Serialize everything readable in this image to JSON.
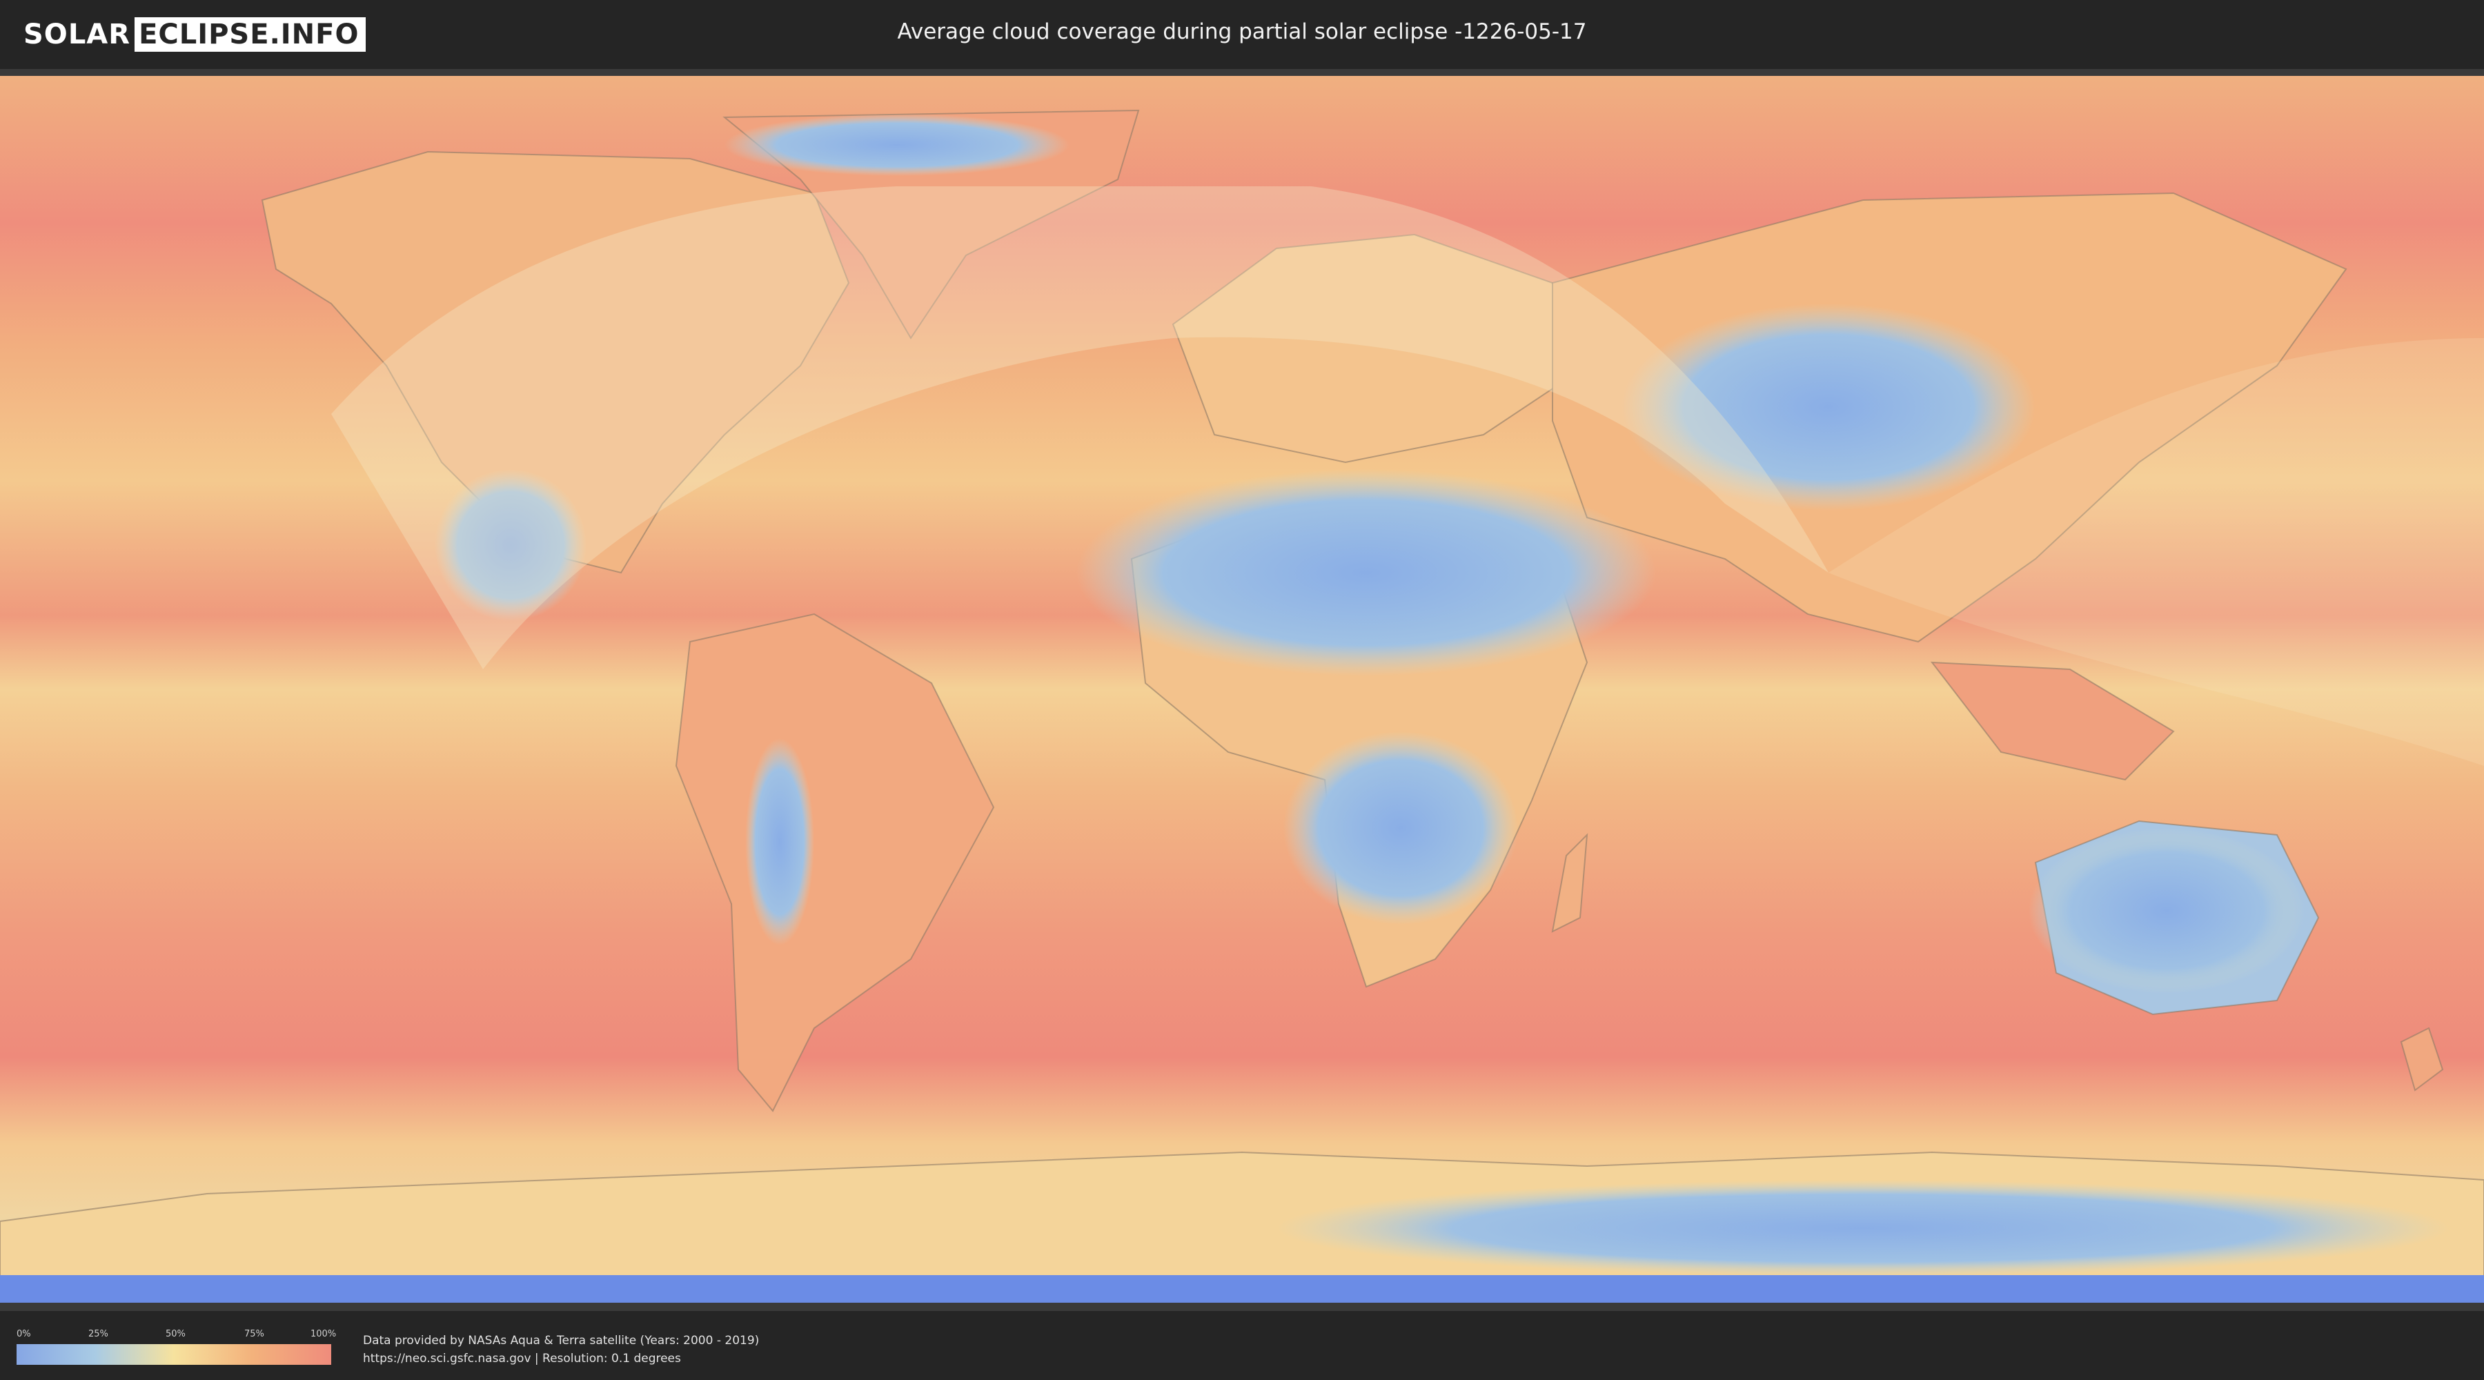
{
  "header": {
    "logo_left": "SOLAR",
    "logo_right": "ECLIPSE.INFO",
    "title": "Average cloud coverage during partial solar eclipse -1226-05-17"
  },
  "colors": {
    "background": "#2a2a2a",
    "header_bg": "#252525",
    "cloud_low": "#86a6e4",
    "cloud_mid_low": "#a9cbe4",
    "cloud_mid": "#f6e29e",
    "cloud_mid_high": "#f3b27c",
    "cloud_high": "#ef8c7c",
    "eclipse_visibility_overlay": "#f7ecc8"
  },
  "map": {
    "type": "world cloud coverage map",
    "projection": "equirectangular",
    "regions_shown": [
      "North America",
      "Greenland",
      "South America",
      "Europe",
      "Africa",
      "Asia",
      "Australia",
      "Antarctica"
    ],
    "eclipse_overlay": "partial eclipse visibility zone over Europe, Africa, Middle East, North Atlantic and Americas"
  },
  "legend": {
    "ticks": [
      "0%",
      "25%",
      "50%",
      "75%",
      "100%"
    ],
    "scale": "cloud coverage 0% (blue) to 100% (red)"
  },
  "footer": {
    "credit_line1": "Data provided by NASAs Aqua & Terra satellite (Years: 2000 - 2019)",
    "credit_line2": "https://neo.sci.gsfc.nasa.gov | Resolution: 0.1 degrees"
  }
}
